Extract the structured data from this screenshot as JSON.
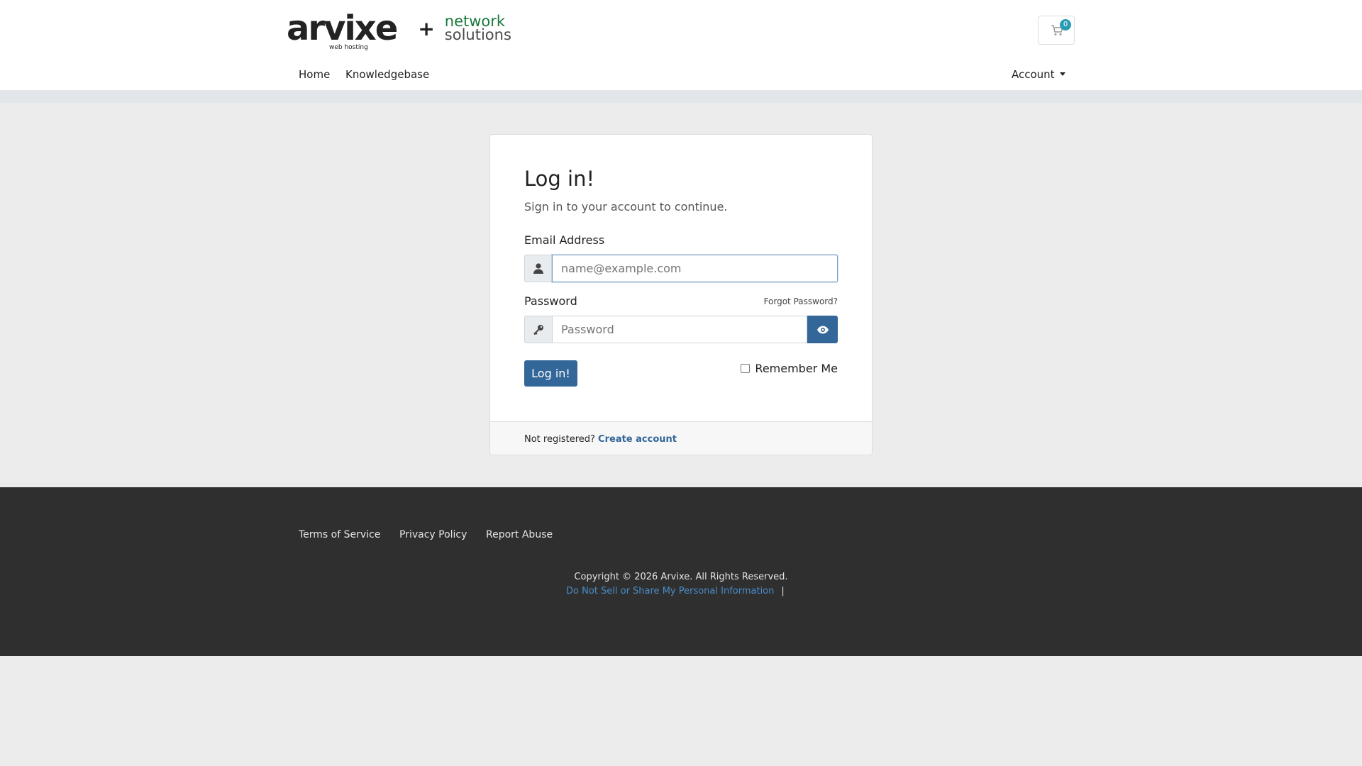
{
  "brand": {
    "logo_main": "arvixe",
    "logo_sub": "web hosting",
    "logo_plus": "+",
    "partner_line1": "network",
    "partner_line2": "solutions"
  },
  "cart": {
    "count": "0",
    "icon": "cart-icon"
  },
  "nav": {
    "home": "Home",
    "knowledgebase": "Knowledgebase",
    "account": "Account"
  },
  "login": {
    "title": "Log in!",
    "subtitle": "Sign in to your account to continue.",
    "email_label": "Email Address",
    "email_placeholder": "name@example.com",
    "email_value": "",
    "password_label": "Password",
    "password_placeholder": "Password",
    "forgot": "Forgot Password?",
    "submit": "Log in!",
    "remember": "Remember Me",
    "not_registered": "Not registered?",
    "create_account": "Create account"
  },
  "footer": {
    "links": [
      "Terms of Service",
      "Privacy Policy",
      "Report Abuse"
    ],
    "copyright": "Copyright © 2026 Arvixe. All Rights Reserved.",
    "dns": "Do Not Sell or Share My Personal Information",
    "pipe": "|"
  },
  "colors": {
    "primary": "#336699",
    "footer_bg": "#2f2f2f",
    "badge": "#2a9bb5",
    "link": "#4a8cc8"
  }
}
